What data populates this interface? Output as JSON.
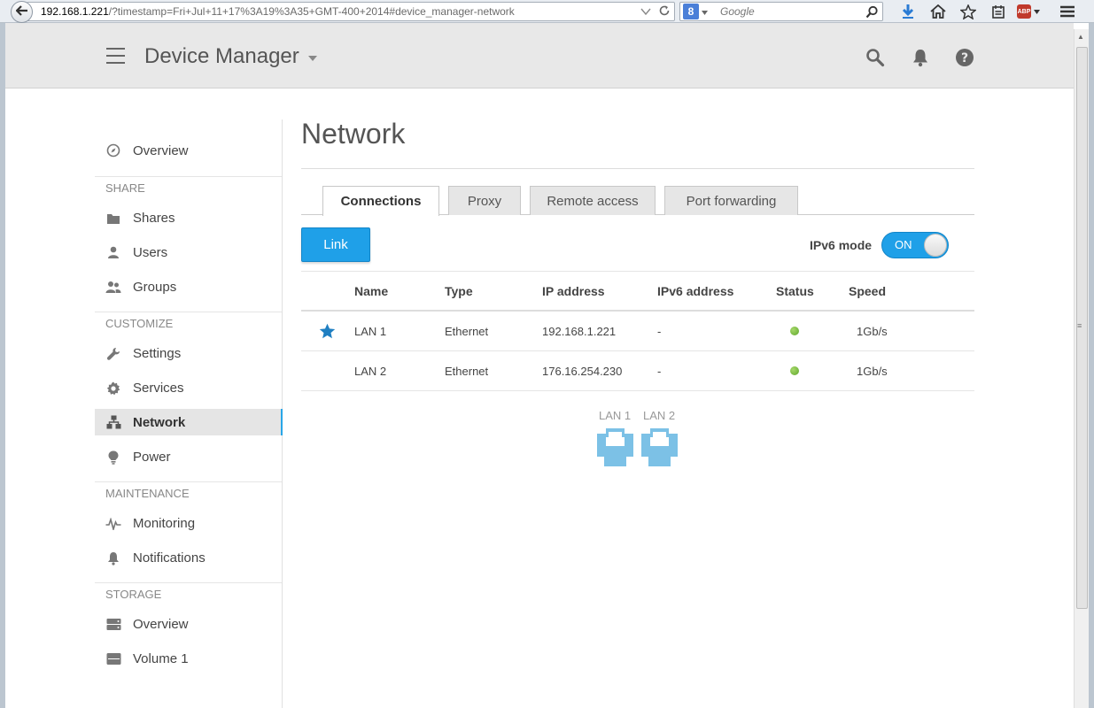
{
  "browser": {
    "url_host": "192.168.1.221",
    "url_rest": "/?timestamp=Fri+Jul+11+17%3A19%3A35+GMT-400+2014#device_manager-network",
    "search_engine_letter": "8",
    "search_placeholder": "Google",
    "abp_label": "ABP"
  },
  "header": {
    "title": "Device Manager"
  },
  "sidebar": {
    "overview": "Overview",
    "sections": {
      "share": "SHARE",
      "customize": "CUSTOMIZE",
      "maintenance": "MAINTENANCE",
      "storage": "STORAGE"
    },
    "share_items": [
      "Shares",
      "Users",
      "Groups"
    ],
    "customize_items": [
      "Settings",
      "Services",
      "Network",
      "Power"
    ],
    "maintenance_items": [
      "Monitoring",
      "Notifications"
    ],
    "storage_items": [
      "Overview",
      "Volume 1"
    ],
    "active": "Network"
  },
  "main": {
    "title": "Network",
    "tabs": [
      "Connections",
      "Proxy",
      "Remote access",
      "Port forwarding"
    ],
    "active_tab": "Connections",
    "link_button": "Link",
    "ipv6_label": "IPv6 mode",
    "ipv6_toggle": "ON",
    "table": {
      "headers": [
        "Name",
        "Type",
        "IP address",
        "IPv6 address",
        "Status",
        "Speed"
      ],
      "rows": [
        {
          "name": "LAN 1",
          "type": "Ethernet",
          "ip": "192.168.1.221",
          "ipv6": "-",
          "speed": "1Gb/s",
          "primary": true
        },
        {
          "name": "LAN 2",
          "type": "Ethernet",
          "ip": "176.16.254.230",
          "ipv6": "-",
          "speed": "1Gb/s",
          "primary": false
        }
      ]
    },
    "ports": [
      "LAN 1",
      "LAN 2"
    ]
  },
  "colors": {
    "accent": "#1fa0e8",
    "status_ok": "#6cb33a",
    "port_icon": "#7cc1e6"
  }
}
